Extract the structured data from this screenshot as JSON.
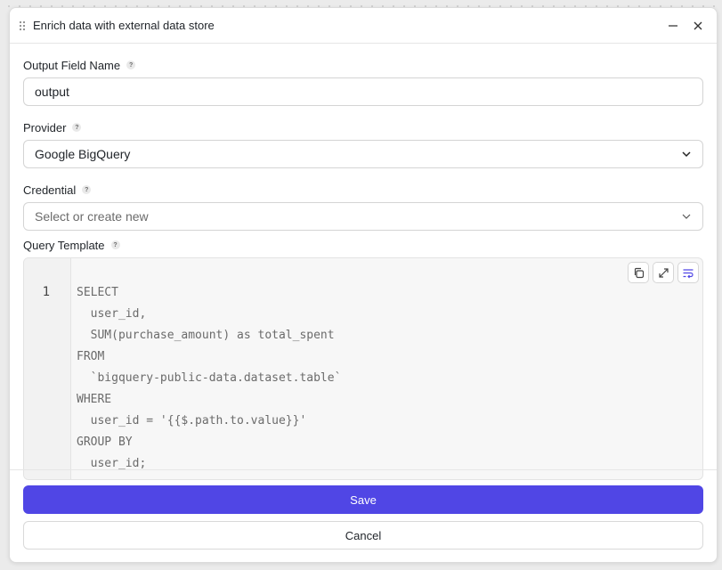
{
  "dialog": {
    "title": "Enrich data with external data store"
  },
  "fields": {
    "output": {
      "label": "Output Field Name",
      "value": "output"
    },
    "provider": {
      "label": "Provider",
      "value": "Google BigQuery"
    },
    "credential": {
      "label": "Credential",
      "placeholder": "Select or create new"
    },
    "query": {
      "label": "Query Template",
      "line_number": "1",
      "code": "SELECT\n  user_id,\n  SUM(purchase_amount) as total_spent\nFROM\n  `bigquery-public-data.dataset.table`\nWHERE\n  user_id = '{{$.path.to.value}}'\nGROUP BY\n  user_id;"
    }
  },
  "help_glyph": "?",
  "buttons": {
    "save": "Save",
    "cancel": "Cancel"
  },
  "colors": {
    "primary": "#5046e5",
    "accent_icon": "#5046e5"
  },
  "icons": [
    "drag-handle-icon",
    "minimize-icon",
    "close-icon",
    "help-icon",
    "chevron-down-icon",
    "copy-icon",
    "expand-icon",
    "wrap-text-icon"
  ]
}
